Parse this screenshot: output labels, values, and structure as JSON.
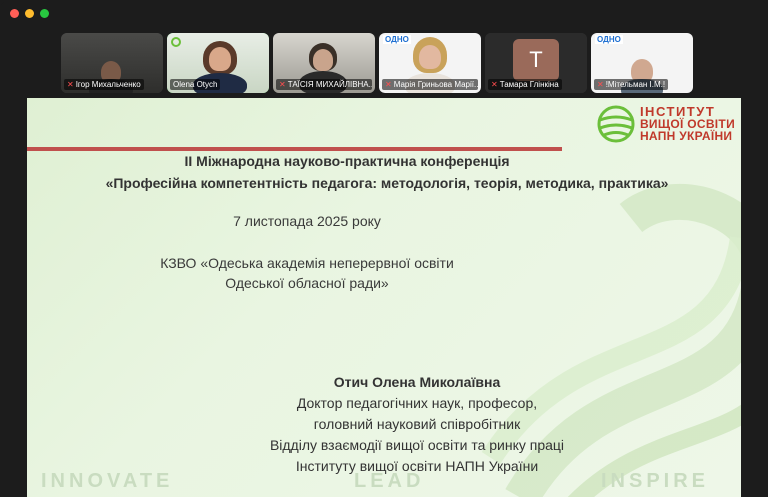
{
  "participants": [
    {
      "name": "Ігор Михальченко",
      "muted": true
    },
    {
      "name": "Olena Otych",
      "muted": false,
      "active": true
    },
    {
      "name": "ТАЇСІЯ МИХАЙЛІВНА...",
      "muted": true
    },
    {
      "name": "Марія Гриньова Марії...",
      "muted": true
    },
    {
      "name": "Тамара Глінкіна",
      "muted": true,
      "avatar_letter": "Т"
    },
    {
      "name": "!Мітельман І.М.!",
      "muted": true
    }
  ],
  "tile_logo": "ОДНО",
  "slide": {
    "logo_lines": [
      "ІНСТИТУТ",
      "ВИЩОЇ ОСВІТИ",
      "НАПН УКРАЇНИ"
    ],
    "title_line1": "ІІ Міжнародна науково-практична конференція",
    "title_line2": "«Професійна компетентність педагога: методологія, теорія, методика, практика»",
    "date": "7 листопада 2025 року",
    "org_line1": "КЗВО «Одеська академія неперервної освіти",
    "org_line2": "Одеської обласної ради»",
    "author": "Отич Олена Миколаївна",
    "affiliation": [
      "Доктор педагогічних наук, професор,",
      "головний науковий співробітник",
      "Відділу взаємодії вищої освіти та ринку праці",
      "Інституту вищої освіти НАПН України"
    ],
    "footer_words": [
      "INNOVATE",
      "LEAD",
      "INSPIRE"
    ]
  },
  "colors": {
    "accent_red": "#c0504d",
    "active_speaker": "#2ecc40",
    "logo_green": "#6bbf3a",
    "logo_red": "#c0392b"
  },
  "icons": {
    "muted": "mic-off-icon"
  }
}
